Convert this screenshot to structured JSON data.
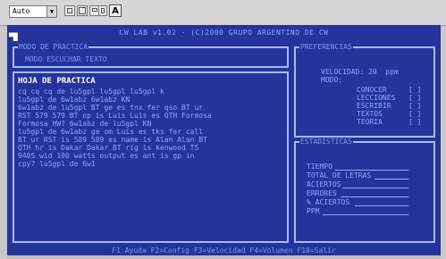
{
  "toolbar": {
    "zoom_select": "Auto",
    "buttons": [
      "copy-icon",
      "fullscreen-icon",
      "window-icon",
      "properties-icon",
      "font-icon"
    ],
    "font_button_label": "A"
  },
  "title": "CW LAB v1.02 - (C)2000 GRUPO ARGENTINO DE CW",
  "modo": {
    "title": "MODO DE PRACTICA",
    "value": "MODO ESCUCHAR TEXTO"
  },
  "hoja": {
    "title": "HOJA DE PRACTICA",
    "lines": [
      "cq cq cq de lu5gpl lu5gpl lu5gpl k",
      "lu5gpl de 6w1abz 6w1abz KN",
      "6w1abz de lu5gpl BT ge es tnx fer qso BT ur",
      "RST 579 579 BT op is Luis Luis es QTH Formosa",
      "Formosa HW? 6w1abz de lu5gpl KN",
      "lu5gpl de 6w1abz ge om Luis es tks fer call",
      "BT ur RST is 589 589 es name is Alan Alan BT",
      "QTH hr is Dakar Dakar BT rig is kenwood TS",
      "940S wid 100 watts output es ant is gp in",
      "cpy? lu5gpl de 6w1"
    ]
  },
  "preferencias": {
    "title": "PREFERENCIAS",
    "velocidad_label": "VELOCIDAD: 20  ppm",
    "modo_label": "MODO:",
    "options": [
      "CONOCER",
      "LECCIONES",
      "ESCRIBIR",
      "TEXTOS",
      "TEORIA"
    ],
    "checkbox": "[ ]"
  },
  "estadisticas": {
    "title": "ESTADISTICAS",
    "rows": [
      "TIEMPO",
      "TOTAL DE LETRAS",
      "ACIERTOS",
      "ERRORES",
      "% ACIERTOS",
      "PPM"
    ]
  },
  "status": "F1 Ayuda  F2=Config  F3=Velocidad  F4=Volumen  F10=Salir",
  "colors": {
    "screen_bg": "#24349a",
    "text": "#8ea8ff",
    "highlight": "#ffffff",
    "border": "#aab8f0"
  }
}
